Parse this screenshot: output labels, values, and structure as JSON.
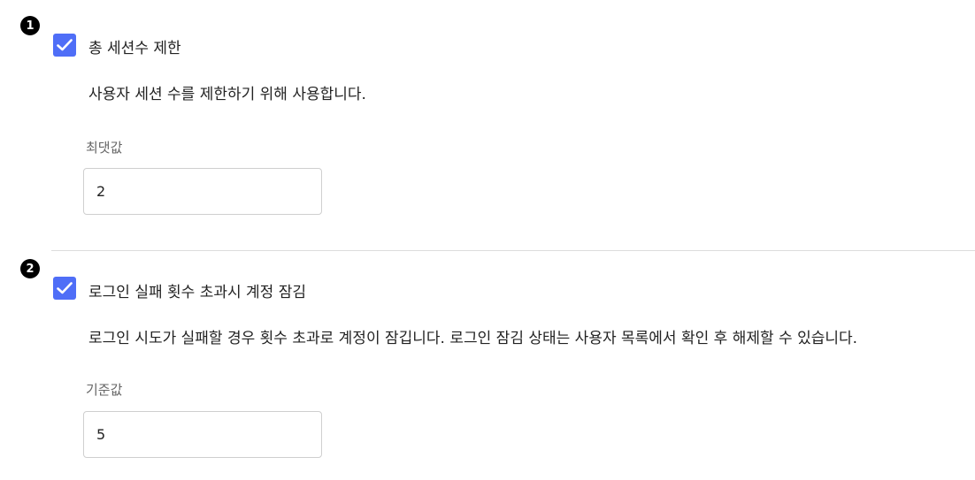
{
  "sections": [
    {
      "badge": "1",
      "checked": true,
      "title": "총 세션수 제한",
      "description": "사용자 세션 수를 제한하기 위해 사용합니다.",
      "field_label": "최댓값",
      "field_value": "2"
    },
    {
      "badge": "2",
      "checked": true,
      "title": "로그인 실패 횟수 초과시 계정 잠김",
      "description": "로그인 시도가 실패할 경우 횟수 초과로 계정이 잠깁니다. 로그인 잠김 상태는 사용자 목록에서 확인 후 해제할 수 있습니다.",
      "field_label": "기준값",
      "field_value": "5"
    }
  ],
  "colors": {
    "checkbox": "#4f6ef7",
    "badge": "#000000"
  },
  "icons": {
    "check": "check-icon"
  }
}
